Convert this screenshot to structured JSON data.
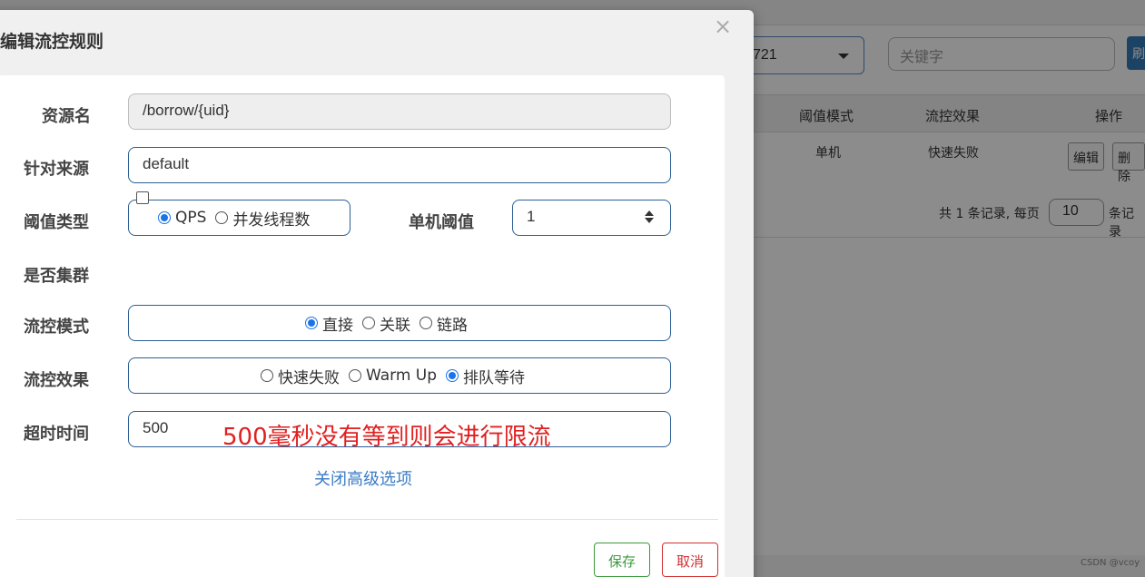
{
  "background": {
    "select_value": "721",
    "search_placeholder": "关键字",
    "search_button_label": "刷",
    "table": {
      "headers": [
        "阈值模式",
        "流控效果",
        "操作"
      ],
      "row": {
        "mode": "单机",
        "effect": "快速失败",
        "edit_label": "编辑",
        "delete_label": "删除"
      }
    },
    "pager": {
      "prefix": "共 1 条记录, 每页",
      "page_size": "10",
      "suffix": "条记录"
    },
    "watermark": "CSDN @vcoy"
  },
  "modal": {
    "title": "编辑流控规则",
    "close_glyph": "×",
    "resource_name": {
      "label": "资源名",
      "value": "/borrow/{uid}"
    },
    "limit_app": {
      "label": "针对来源",
      "value": "default"
    },
    "grade": {
      "label": "阈值类型",
      "options": [
        {
          "label": "QPS",
          "selected": true
        },
        {
          "label": "并发线程数",
          "selected": false
        }
      ]
    },
    "count": {
      "label": "单机阈值",
      "value": "1"
    },
    "cluster": {
      "label": "是否集群",
      "checked": false
    },
    "strategy": {
      "label": "流控模式",
      "options": [
        {
          "label": "直接",
          "selected": true
        },
        {
          "label": "关联",
          "selected": false
        },
        {
          "label": "链路",
          "selected": false
        }
      ]
    },
    "control_behavior": {
      "label": "流控效果",
      "options": [
        {
          "label": "快速失败",
          "selected": false
        },
        {
          "label": "Warm Up",
          "selected": false
        },
        {
          "label": "排队等待",
          "selected": true
        }
      ]
    },
    "timeout": {
      "label": "超时时间",
      "value": "500"
    },
    "annotation": "500毫秒没有等到则会进行限流",
    "advanced_link": "关闭高级选项",
    "save_label": "保存",
    "cancel_label": "取消"
  },
  "colors": {
    "accent": "#1a73e8",
    "save": "#3c9a3c",
    "cancel": "#d03030",
    "annotation": "#e02020",
    "link": "#3a7cc6"
  }
}
